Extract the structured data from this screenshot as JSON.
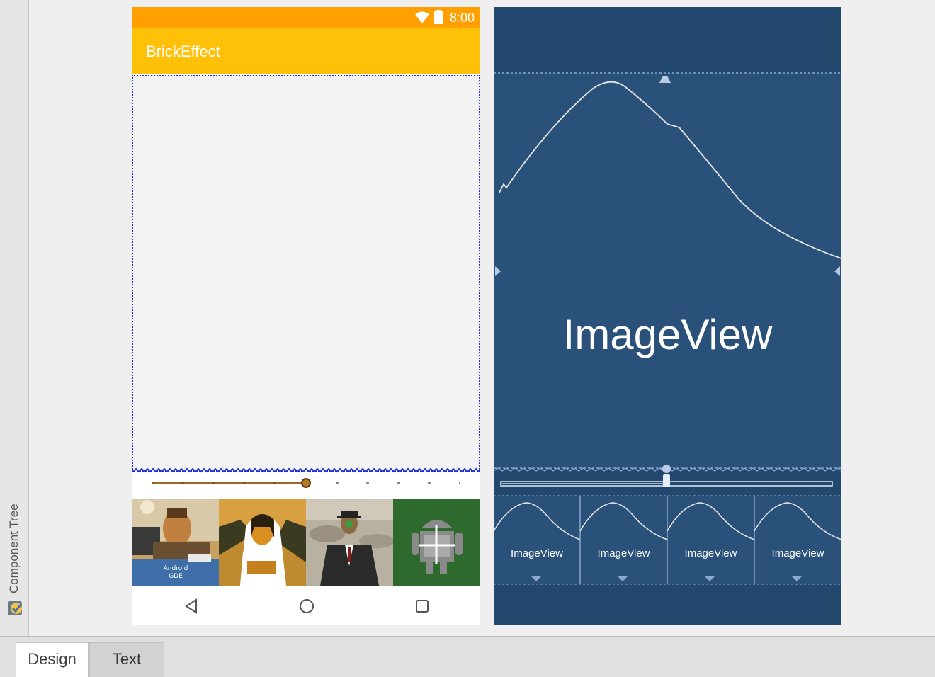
{
  "phone": {
    "time": "8:00",
    "app_title": "BrickEffect",
    "seek_progress": 0.5,
    "thumb1_caption": "Android GDE"
  },
  "blueprint": {
    "main_label": "ImageView",
    "thumb_labels": [
      "ImageView",
      "ImageView",
      "ImageView",
      "ImageView"
    ],
    "seek_progress": 0.5
  },
  "side_panel": {
    "label": "Component Tree"
  },
  "tabs": {
    "design": "Design",
    "text": "Text"
  },
  "colors": {
    "status_bar": "#ffa000",
    "app_bar": "#ffc107",
    "blueprint_bg": "#23486e",
    "selection": "#2233dd"
  }
}
